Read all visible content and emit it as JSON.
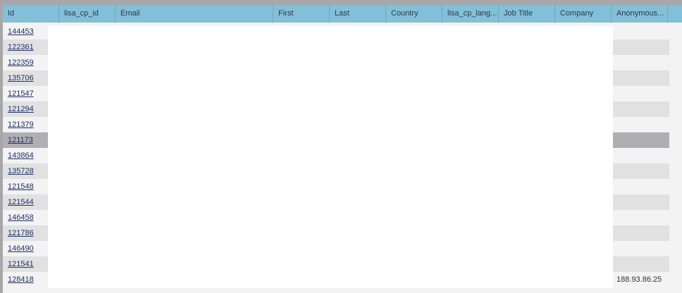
{
  "columns": [
    "Id",
    "lisa_cp_id",
    "Email",
    "First",
    "Last",
    "Country",
    "lisa_cp_lang...",
    "Job Title",
    "Company",
    "Anonymous..."
  ],
  "rows": [
    {
      "id": "144453",
      "anon": ""
    },
    {
      "id": "122361",
      "anon": ""
    },
    {
      "id": "122359",
      "anon": ""
    },
    {
      "id": "135706",
      "anon": ""
    },
    {
      "id": "121547",
      "anon": ""
    },
    {
      "id": "121294",
      "anon": ""
    },
    {
      "id": "121379",
      "anon": ""
    },
    {
      "id": "121173",
      "anon": ""
    },
    {
      "id": "143864",
      "anon": ""
    },
    {
      "id": "135728",
      "anon": ""
    },
    {
      "id": "121548",
      "anon": ""
    },
    {
      "id": "121544",
      "anon": ""
    },
    {
      "id": "146458",
      "anon": ""
    },
    {
      "id": "121786",
      "anon": ""
    },
    {
      "id": "146490",
      "anon": ""
    },
    {
      "id": "121541",
      "anon": ""
    },
    {
      "id": "128418",
      "anon": "188.93.86.25"
    }
  ],
  "selected_row_index": 7
}
